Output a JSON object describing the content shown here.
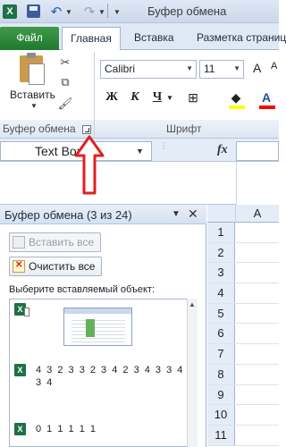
{
  "window": {
    "title_partial": "Буфер обмена",
    "app_icon_letter": "X"
  },
  "quick_access": {
    "save": "save-icon",
    "undo": "undo-icon",
    "redo": "redo-icon",
    "customize": "customize-arrow-icon"
  },
  "tabs": [
    {
      "label": "Файл",
      "active": false
    },
    {
      "label": "Главная",
      "active": true
    },
    {
      "label": "Вставка",
      "active": false
    },
    {
      "label": "Разметка страниц",
      "active": false
    }
  ],
  "ribbon": {
    "clipboard_group": {
      "label": "Буфер обмена",
      "paste_label": "Вставить"
    },
    "font_group": {
      "label": "Шрифт",
      "font_name": "Calibri",
      "font_size": "11",
      "bold": "Ж",
      "italic": "К",
      "underline": "Ч",
      "grow": "A",
      "shrink": "A",
      "font_color_letter": "A",
      "fill_color": "#ffff00",
      "font_color": "#ff0000"
    }
  },
  "formula_bar": {
    "name_box": "Text Box",
    "fx": "fx",
    "dots": "⋮"
  },
  "clipboard_pane": {
    "title": "Буфер обмена (3 из 24)",
    "paste_all": "Вставить все",
    "clear_all": "Очистить все",
    "prompt": "Выберите вставляемый объект:",
    "items": [
      {
        "type": "image",
        "text": ""
      },
      {
        "type": "text",
        "text": "4 3 2 3 3 2 3 4 2 3 4 3 3 4 3 4"
      },
      {
        "type": "text",
        "text": "0 1 1 1 1 1"
      }
    ]
  },
  "sheet": {
    "column_header": "A",
    "rows": [
      "1",
      "2",
      "3",
      "4",
      "5",
      "6",
      "7",
      "8",
      "9",
      "10",
      "11"
    ]
  },
  "colors": {
    "file_tab": "#2f8a3d",
    "annotation_arrow": "#e02020",
    "ribbon_accent": "#dfe9f5"
  }
}
